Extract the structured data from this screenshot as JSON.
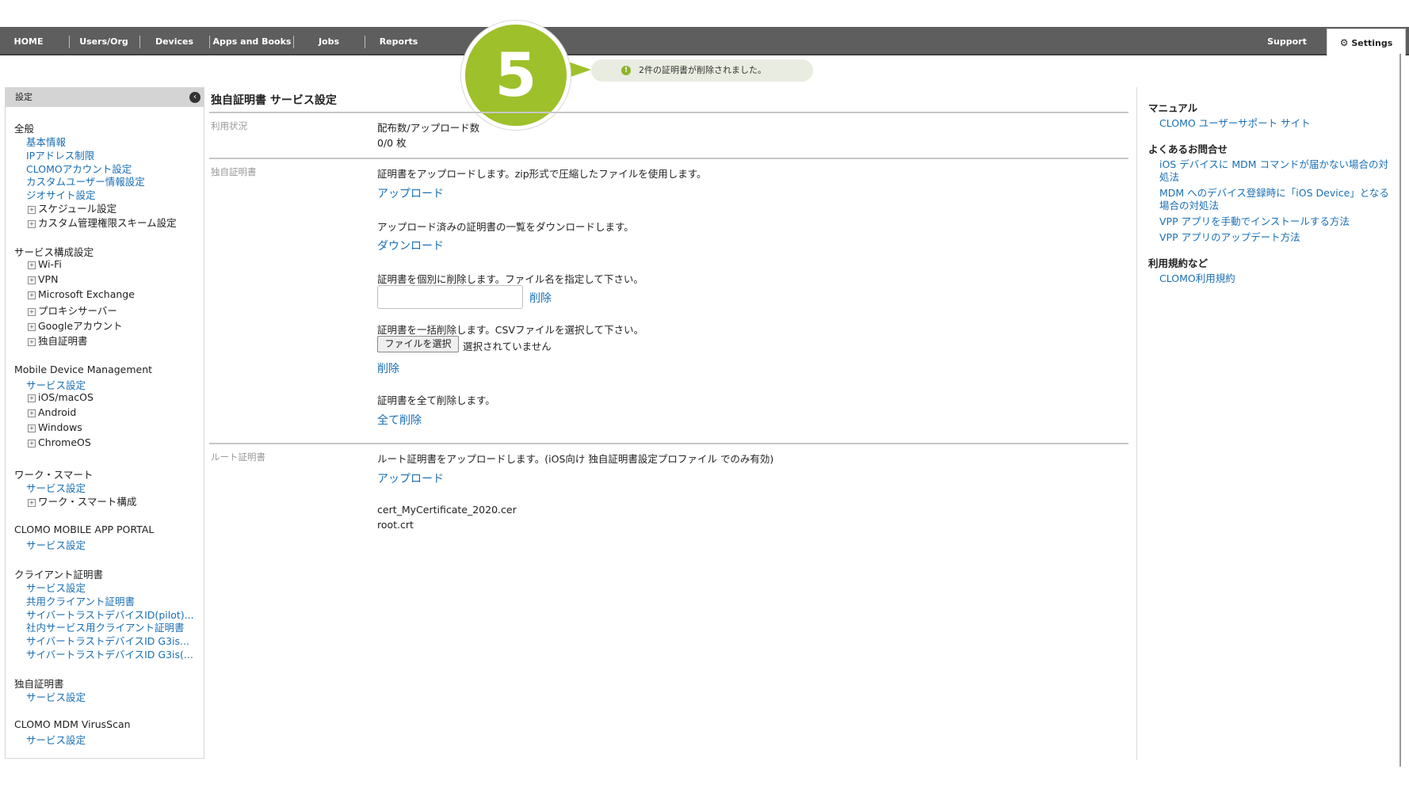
{
  "nav": {
    "items": [
      "HOME",
      "Users/Org",
      "Devices",
      "Apps and Books",
      "Jobs",
      "Reports"
    ],
    "support": "Support",
    "settings": "Settings"
  },
  "step_badge": "5",
  "toast": {
    "icon": "exclamation-icon",
    "message": "2件の証明書が削除されました。"
  },
  "sidebar": {
    "header": "設定",
    "sections": [
      {
        "title": "全般",
        "links": [
          "基本情報",
          "IPアドレス制限",
          "CLOMOアカウント設定",
          "カスタムユーザー情報設定",
          "ジオサイト設定"
        ],
        "trees": [
          "スケジュール設定",
          "カスタム管理権限スキーム設定"
        ]
      },
      {
        "title": "サービス構成設定",
        "links": [],
        "trees": [
          "Wi-Fi",
          "VPN",
          "Microsoft Exchange",
          "プロキシサーバー",
          "Googleアカウント",
          "独自証明書"
        ]
      },
      {
        "title": "Mobile Device Management",
        "links": [
          "サービス設定"
        ],
        "trees": [
          "iOS/macOS",
          "Android",
          "Windows",
          "ChromeOS"
        ]
      },
      {
        "title": "ワーク・スマート",
        "links": [
          "サービス設定"
        ],
        "trees": [
          "ワーク・スマート構成"
        ]
      },
      {
        "title": "CLOMO MOBILE APP PORTAL",
        "links": [
          "サービス設定"
        ],
        "trees": []
      },
      {
        "title": "クライアント証明書",
        "links": [
          "サービス設定",
          "共用クライアント証明書",
          "サイバートラストデバイスID(pilot)...",
          "社内サービス用クライアント証明書",
          "サイバートラストデバイスID G3is...",
          "サイバートラストデバイスID G3is(..."
        ],
        "trees": []
      },
      {
        "title": "独自証明書",
        "links": [
          "サービス設定"
        ],
        "trees": []
      },
      {
        "title": "CLOMO MDM VirusScan",
        "links": [
          "サービス設定"
        ],
        "trees": []
      }
    ]
  },
  "main": {
    "title": "独自証明書 サービス設定",
    "usage": {
      "label": "利用状況",
      "heading": "配布数/アップロード数",
      "value": "0/0 枚"
    },
    "custom_cert": {
      "label": "独自証明書",
      "upload_desc": "証明書をアップロードします。zip形式で圧縮したファイルを使用します。",
      "upload_link": "アップロード",
      "download_desc": "アップロード済みの証明書の一覧をダウンロードします。",
      "download_link": "ダウンロード",
      "delete_one_desc": "証明書を個別に削除します。ファイル名を指定して下さい。",
      "delete_one_placeholder": "",
      "delete_one_link": "削除",
      "bulk_desc": "証明書を一括削除します。CSVファイルを選択して下さい。",
      "file_button": "ファイルを選択",
      "file_status": "選択されていません",
      "bulk_delete_link": "削除",
      "delete_all_desc": "証明書を全て削除します。",
      "delete_all_link": "全て削除"
    },
    "root_cert": {
      "label": "ルート証明書",
      "upload_desc": "ルート証明書をアップロードします。(iOS向け 独自証明書設定プロファイル でのみ有効)",
      "upload_link": "アップロード",
      "files": [
        "cert_MyCertificate_2020.cer",
        "root.crt"
      ]
    }
  },
  "right_panel": {
    "manual_title": "マニュアル",
    "manual_links": [
      "CLOMO ユーザーサポート サイト"
    ],
    "faq_title": "よくあるお問合せ",
    "faq_links": [
      "iOS デバイスに MDM コマンドが届かない場合の対処法",
      "MDM へのデバイス登録時に「iOS Device」となる場合の対処法",
      "VPP アプリを手動でインストールする方法",
      "VPP アプリのアップデート方法"
    ],
    "terms_title": "利用規約など",
    "terms_links": [
      "CLOMO利用規約"
    ]
  }
}
